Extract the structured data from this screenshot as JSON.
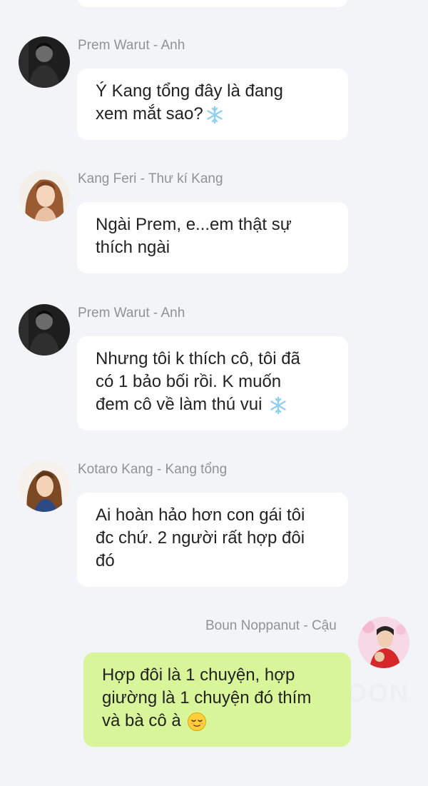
{
  "messages": [
    {
      "sender": "Prem Warut - Anh",
      "avatar_icon": "prem-avatar",
      "lines": [
        "Ý Kang tổng đây là đang",
        "xem mắt sao?"
      ],
      "trailing_emoji": "snowflake-icon"
    },
    {
      "sender": "Kang Feri - Thư kí Kang",
      "avatar_icon": "feri-avatar",
      "lines": [
        "Ngài Prem, e...em thật sự",
        "thích ngài"
      ]
    },
    {
      "sender": "Prem Warut - Anh",
      "avatar_icon": "prem-avatar",
      "lines": [
        "Nhưng tôi k thích cô, tôi đã",
        "có 1 bảo bối rồi. K muốn",
        "đem cô về làm thú vui"
      ],
      "trailing_emoji": "snowflake-icon"
    },
    {
      "sender": "Kotaro Kang - Kang tổng",
      "avatar_icon": "kotaro-avatar",
      "lines": [
        "Ai hoàn hảo hơn con gái tôi",
        "đc chứ. 2 người rất hợp đôi",
        "đó"
      ]
    },
    {
      "sender": "Boun Noppanut - Cậu",
      "avatar_icon": "boun-avatar",
      "lines": [
        "Hợp đôi là 1 chuyện, hợp",
        "giường là 1 chuyện đó thím",
        "và bà cô à"
      ],
      "trailing_emoji": "relieved-face-icon",
      "outgoing": true
    }
  ],
  "watermark": "OON",
  "colors": {
    "background": "#f3f4f7",
    "incoming_bubble": "#ffffff",
    "outgoing_bubble": "#d9f59a",
    "sender_text": "#8f9296",
    "message_text": "#222222"
  }
}
